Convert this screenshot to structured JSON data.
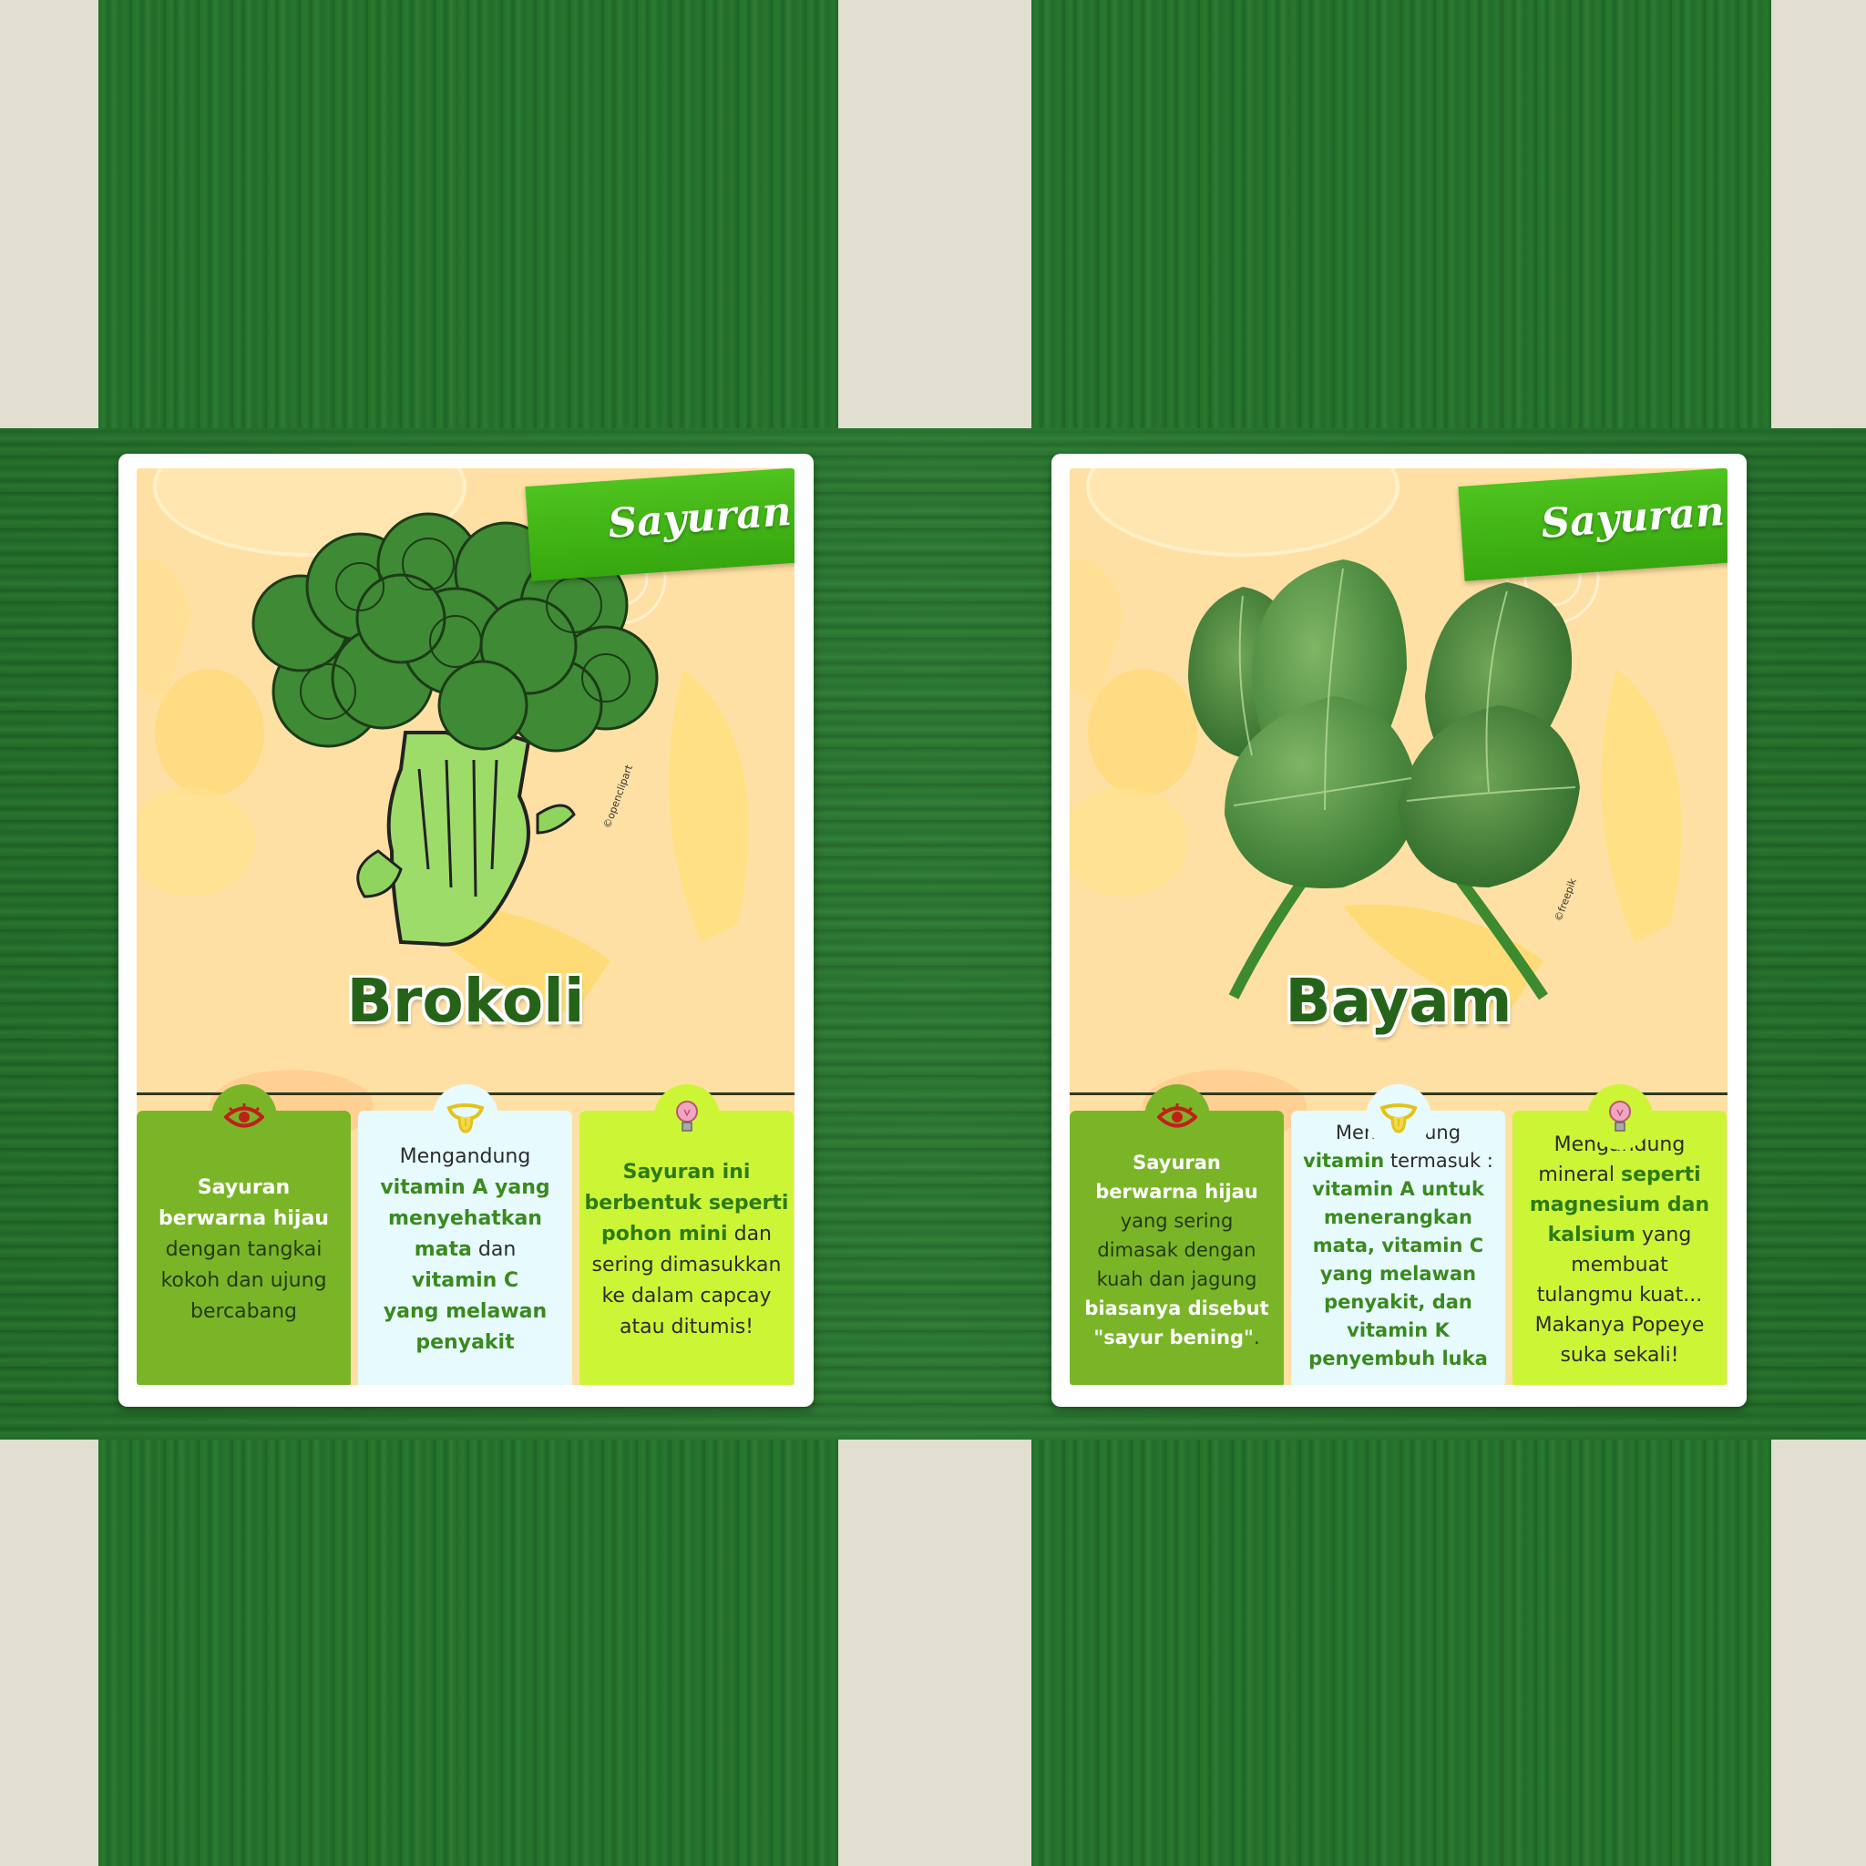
{
  "cards": [
    {
      "category": "Sayuran",
      "name": "Brokoli",
      "credit": "©openclipart",
      "icons": [
        "eye-icon",
        "tongue-icon",
        "lightbulb-icon"
      ],
      "box1": {
        "b1": "Sayuran",
        "b2": "berwarna hijau",
        "t1": "dengan tangkai",
        "t2": "kokoh dan ujung",
        "t3": "bercabang"
      },
      "box2": {
        "t1": "Mengandung",
        "h1": "vitamin A yang",
        "h2": "menyehatkan",
        "h3": "mata",
        "t2": "dan",
        "h4": "vitamin C",
        "h5": "yang melawan",
        "h6": "penyakit"
      },
      "box3": {
        "h1": "Sayuran ini",
        "h2": "berbentuk seperti",
        "h3": "pohon mini",
        "t1": "dan",
        "t2": "sering dimasukkan",
        "t3": "ke dalam capcay",
        "t4": "atau ditumis!"
      }
    },
    {
      "category": "Sayuran",
      "name": "Bayam",
      "credit": "©freepik",
      "icons": [
        "eye-icon",
        "tongue-icon",
        "lightbulb-icon"
      ],
      "box1": {
        "b1": "Sayuran",
        "b2": "berwarna hijau",
        "t1": "yang sering",
        "t2": "dimasak dengan",
        "t3": "kuah dan jagung",
        "b3": "biasanya disebut",
        "b4": "\"sayur bening\"",
        "t4": "."
      },
      "box2": {
        "t1": "Mengandung",
        "h1": "vitamin",
        "t2": "termasuk :",
        "h2": "vitamin A untuk",
        "h3": "menerangkan",
        "h4": "mata, vitamin C",
        "h5": "yang melawan",
        "h6": "penyakit, dan",
        "h7": "vitamin K",
        "h8": "penyembuh luka"
      },
      "box3": {
        "t1": "Mengandung",
        "t2": "mineral",
        "h1": "seperti",
        "h2": "magnesium dan",
        "h3": "kalsium",
        "t3": "yang",
        "t4": "membuat",
        "t5": "tulangmu kuat...",
        "t6": "Makanya Popeye",
        "t7": "suka sekali!"
      }
    }
  ],
  "colors": {
    "band": "#236f2a",
    "background": "#e0dfd0",
    "card_bg": "#ffe0a4",
    "banner": "#40b414",
    "title": "#256319",
    "box1": "#7ab528",
    "box2": "#e7fafd",
    "box3": "#ccf536"
  }
}
